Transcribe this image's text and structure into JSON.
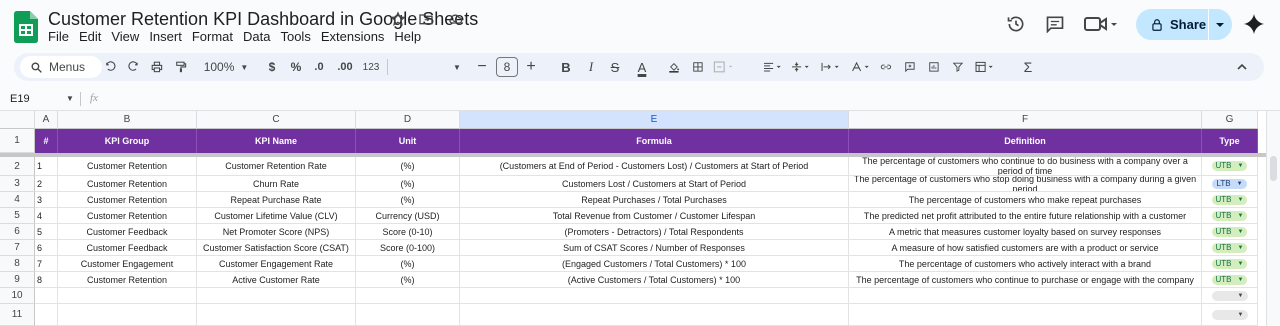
{
  "app": {
    "title": "Customer Retention KPI Dashboard in Google Sheets",
    "menu": [
      "File",
      "Edit",
      "View",
      "Insert",
      "Format",
      "Data",
      "Tools",
      "Extensions",
      "Help"
    ],
    "share_label": "Share",
    "icons": [
      "star-icon",
      "move-icon",
      "cloud-status-icon",
      "history-icon",
      "comments-icon",
      "meet-icon",
      "gemini-icon"
    ]
  },
  "toolbar": {
    "menus_label": "Menus",
    "zoom": "100%",
    "currency": "$",
    "percent": "%",
    "dec_decrease": ".0",
    "dec_increase": ".00",
    "number_format": "123",
    "font_size": "8",
    "minus": "−",
    "plus": "+",
    "bold": "B",
    "italic": "I",
    "strike": "S",
    "text_color": "A",
    "sigma": "Σ"
  },
  "formula_bar": {
    "name_box": "E19",
    "fx": "fx",
    "value": ""
  },
  "grid": {
    "column_letters": [
      "A",
      "B",
      "C",
      "D",
      "E",
      "F",
      "G"
    ],
    "headers": [
      "#",
      "KPI Group",
      "KPI Name",
      "Unit",
      "Formula",
      "Definition",
      "Type"
    ],
    "rows": [
      {
        "num": "1",
        "group": "Customer Retention",
        "name": "Customer Retention Rate",
        "unit": "(%)",
        "formula": "(Customers at End of Period - Customers Lost) / Customers at Start of Period",
        "definition": "The percentage of customers who continue to do business with a company over a period of time",
        "type": "UTB"
      },
      {
        "num": "2",
        "group": "Customer Retention",
        "name": "Churn Rate",
        "unit": "(%)",
        "formula": "Customers Lost / Customers at Start of Period",
        "definition": "The percentage of customers who stop doing business with a company during a given period",
        "type": "LTB"
      },
      {
        "num": "3",
        "group": "Customer Retention",
        "name": "Repeat Purchase Rate",
        "unit": "(%)",
        "formula": "Repeat Purchases / Total Purchases",
        "definition": "The percentage of customers who make repeat purchases",
        "type": "UTB"
      },
      {
        "num": "4",
        "group": "Customer Retention",
        "name": "Customer Lifetime Value (CLV)",
        "unit": "Currency (USD)",
        "formula": "Total Revenue from Customer / Customer Lifespan",
        "definition": "The predicted net profit attributed to the entire future relationship with a customer",
        "type": "UTB"
      },
      {
        "num": "5",
        "group": "Customer Feedback",
        "name": "Net Promoter Score (NPS)",
        "unit": "Score (0-10)",
        "formula": "(Promoters - Detractors) / Total Respondents",
        "definition": "A metric that measures customer loyalty based on survey responses",
        "type": "UTB"
      },
      {
        "num": "6",
        "group": "Customer Feedback",
        "name": "Customer Satisfaction Score (CSAT)",
        "unit": "Score (0-100)",
        "formula": "Sum of CSAT Scores / Number of Responses",
        "definition": "A measure of how satisfied customers are with a product or service",
        "type": "UTB"
      },
      {
        "num": "7",
        "group": "Customer Engagement",
        "name": "Customer Engagement Rate",
        "unit": "(%)",
        "formula": "(Engaged Customers / Total Customers) * 100",
        "definition": "The percentage of customers who actively interact with a brand",
        "type": "UTB"
      },
      {
        "num": "8",
        "group": "Customer Retention",
        "name": "Active Customer Rate",
        "unit": "(%)",
        "formula": "(Active Customers / Total Customers) * 100",
        "definition": "The percentage of customers who continue to purchase or engage with the company",
        "type": "UTB"
      }
    ],
    "row_numbers": [
      "1",
      "2",
      "3",
      "4",
      "5",
      "6",
      "7",
      "8",
      "9",
      "10",
      "11"
    ]
  },
  "colors": {
    "header_purple": "#7030a0",
    "share_bg": "#c2e7ff",
    "utb_chip": "#d4edbc",
    "ltb_chip": "#c6dbf7"
  }
}
